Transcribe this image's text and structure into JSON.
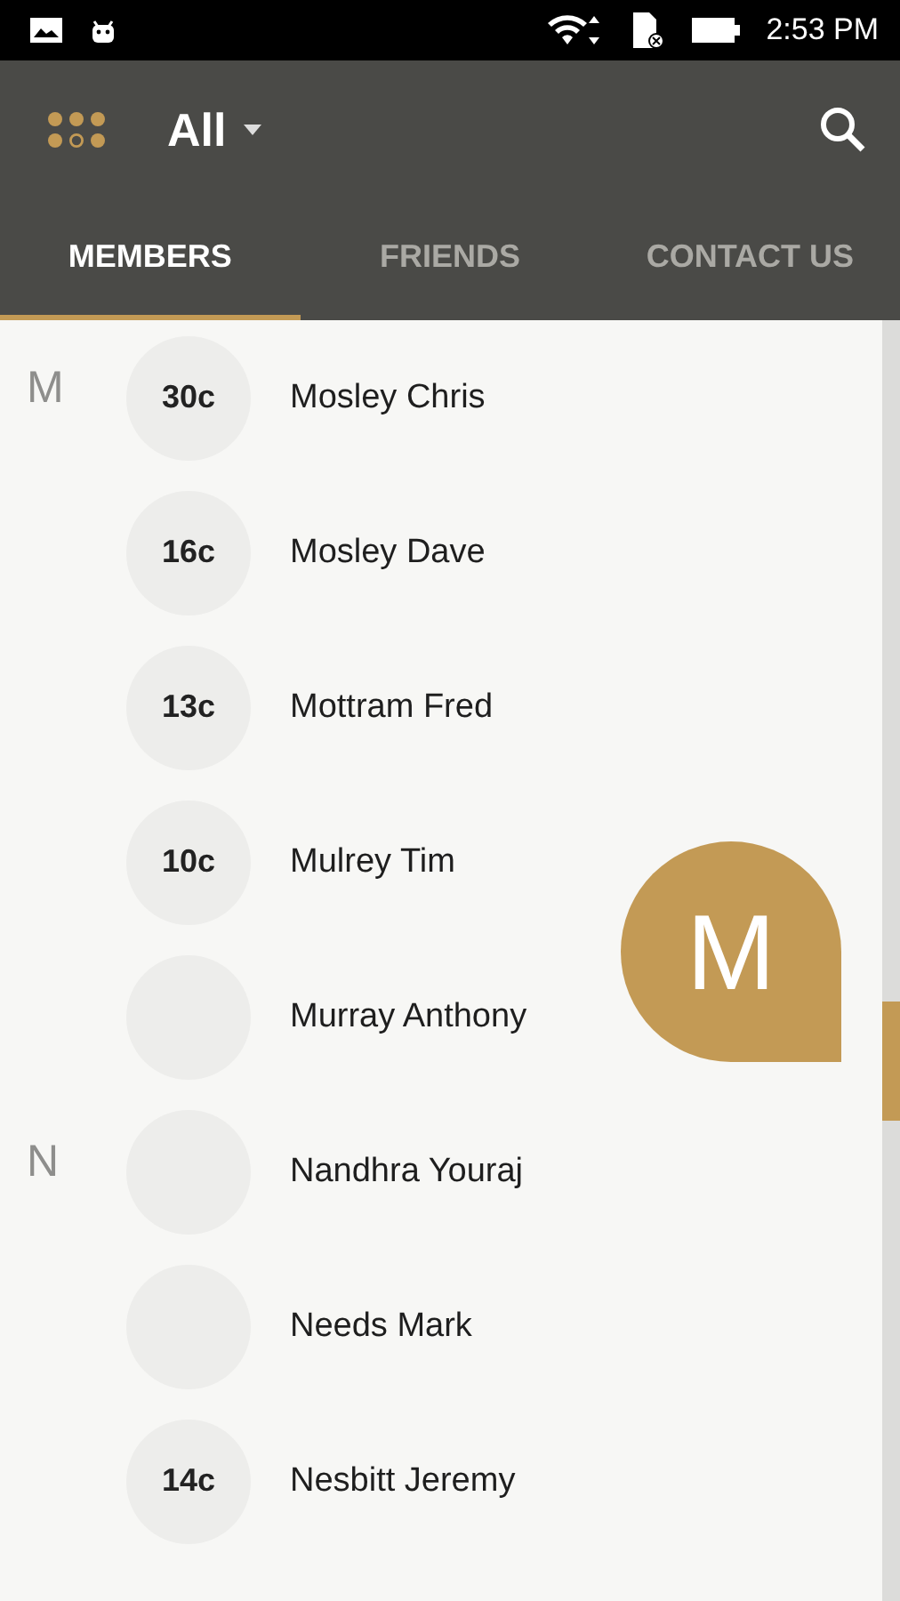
{
  "status_bar": {
    "time": "2:53 PM"
  },
  "app_bar": {
    "filter": "All"
  },
  "tabs": [
    {
      "label": "MEMBERS",
      "selected": true
    },
    {
      "label": "FRIENDS",
      "selected": false
    },
    {
      "label": "CONTACT US",
      "selected": false
    }
  ],
  "sections": [
    {
      "letter": "M",
      "members": [
        {
          "credit": "30c",
          "name": "Mosley Chris"
        },
        {
          "credit": "16c",
          "name": "Mosley Dave"
        },
        {
          "credit": "13c",
          "name": "Mottram Fred"
        },
        {
          "credit": "10c",
          "name": "Mulrey Tim"
        },
        {
          "name": "Murray Anthony"
        }
      ]
    },
    {
      "letter": "N",
      "members": [
        {
          "name": "Nandhra Youraj"
        },
        {
          "name": "Needs Mark"
        },
        {
          "credit": "14c",
          "name": "Nesbitt Jeremy"
        }
      ]
    }
  ],
  "fast_scroll": {
    "letter": "M"
  }
}
